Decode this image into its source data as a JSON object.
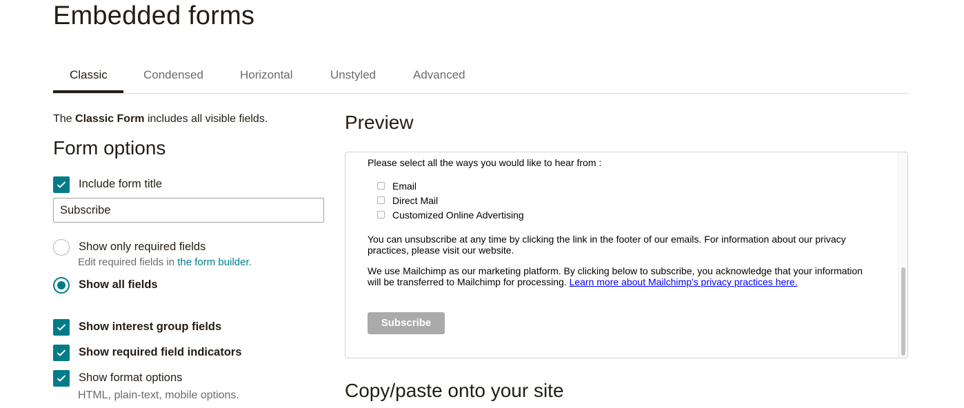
{
  "page": {
    "title": "Embedded forms"
  },
  "tabs": [
    {
      "label": "Classic",
      "active": true
    },
    {
      "label": "Condensed",
      "active": false
    },
    {
      "label": "Horizontal",
      "active": false
    },
    {
      "label": "Unstyled",
      "active": false
    },
    {
      "label": "Advanced",
      "active": false
    }
  ],
  "intro": {
    "prefix": "The",
    "form_name": "Classic Form",
    "suffix": "includes all visible fields."
  },
  "form_options": {
    "heading": "Form options",
    "include_title": {
      "label": "Include form title",
      "checked": true
    },
    "title_input": {
      "value": "Subscribe"
    },
    "show_required": {
      "label": "Show only required fields",
      "selected": false
    },
    "required_hint": {
      "prefix": "Edit required fields in",
      "link": "the form builder."
    },
    "show_all": {
      "label": "Show all fields",
      "selected": true
    },
    "interest_groups": {
      "label": "Show interest group fields",
      "checked": true
    },
    "required_indicators": {
      "label": "Show required field indicators",
      "checked": true
    },
    "format_options": {
      "label": "Show format options",
      "checked": true
    },
    "format_hint": "HTML, plain-text, mobile options."
  },
  "preview": {
    "heading": "Preview",
    "question": "Please select all the ways you would like to hear from :",
    "options": [
      "Email",
      "Direct Mail",
      "Customized Online Advertising"
    ],
    "unsubscribe_line1": "You can unsubscribe at any time by clicking the link in the footer of our emails. For information about our privacy",
    "unsubscribe_line2": "practices, please visit our website.",
    "platform_line1": "We use Mailchimp as our marketing platform. By clicking below to subscribe, you acknowledge that your information",
    "platform_line2_prefix": "will be transferred to Mailchimp for processing.",
    "platform_link": "Learn more about Mailchimp's privacy practices here.",
    "button_label": "Subscribe"
  },
  "copy_section": {
    "heading": "Copy/paste onto your site"
  },
  "colors": {
    "accent": "#007c89",
    "text": "#241c15",
    "muted": "#6b6b6b",
    "button_disabled": "#aaaaaa"
  },
  "icons": {
    "checkbox": "checkmark-icon"
  }
}
